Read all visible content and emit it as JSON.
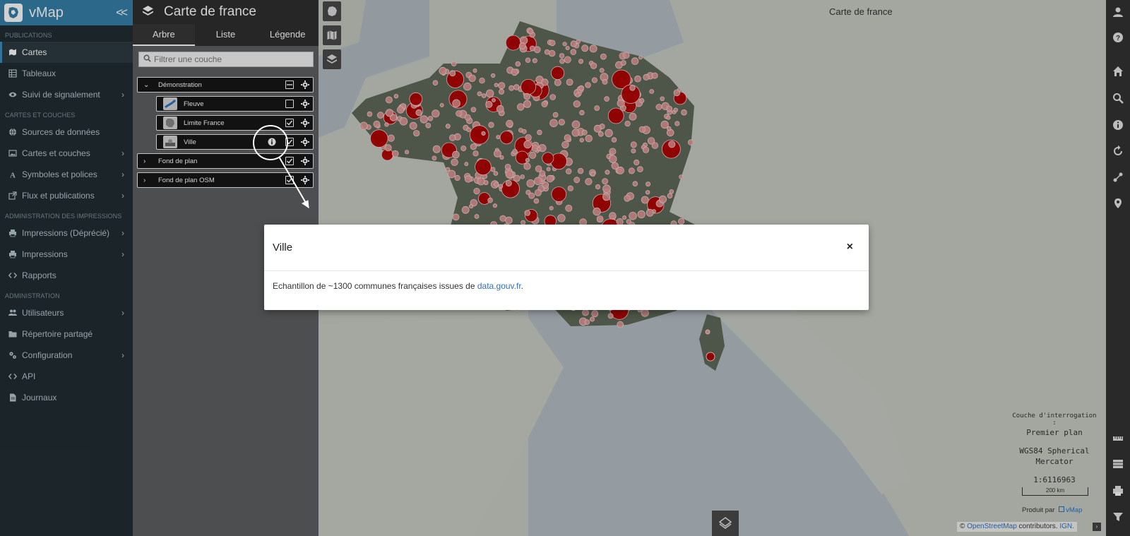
{
  "app": {
    "name": "vMap",
    "collapse_glyph": "<<"
  },
  "sidebar": {
    "sections": [
      {
        "header": "PUBLICATIONS",
        "items": [
          {
            "label": "Cartes",
            "icon": "map-icon",
            "active": true,
            "chevron": false
          },
          {
            "label": "Tableaux",
            "icon": "table-icon",
            "active": false,
            "chevron": false
          },
          {
            "label": "Suivi de signalement",
            "icon": "eye-icon",
            "active": false,
            "chevron": true
          }
        ]
      },
      {
        "header": "CARTES ET COUCHES",
        "items": [
          {
            "label": "Sources de données",
            "icon": "globe-icon",
            "active": false,
            "chevron": false
          },
          {
            "label": "Cartes et couches",
            "icon": "image-icon",
            "active": false,
            "chevron": true
          },
          {
            "label": "Symboles et polices",
            "icon": "font-icon",
            "active": false,
            "chevron": true
          },
          {
            "label": "Flux et publications",
            "icon": "external-link-icon",
            "active": false,
            "chevron": true
          }
        ]
      },
      {
        "header": "ADMINISTRATION DES IMPRESSIONS",
        "items": [
          {
            "label": "Impressions (Déprécié)",
            "icon": "print-icon",
            "active": false,
            "chevron": true
          },
          {
            "label": "Impressions",
            "icon": "print-icon",
            "active": false,
            "chevron": true
          },
          {
            "label": "Rapports",
            "icon": "code-icon",
            "active": false,
            "chevron": false
          }
        ]
      },
      {
        "header": "ADMINISTRATION",
        "items": [
          {
            "label": "Utilisateurs",
            "icon": "users-icon",
            "active": false,
            "chevron": true
          },
          {
            "label": "Répertoire partagé",
            "icon": "folder-icon",
            "active": false,
            "chevron": false
          },
          {
            "label": "Configuration",
            "icon": "cogs-icon",
            "active": false,
            "chevron": true
          },
          {
            "label": "API",
            "icon": "code-icon",
            "active": false,
            "chevron": false
          },
          {
            "label": "Journaux",
            "icon": "file-icon",
            "active": false,
            "chevron": false
          }
        ]
      }
    ]
  },
  "panel": {
    "title": "Carte de france",
    "tabs": [
      {
        "label": "Arbre",
        "active": true
      },
      {
        "label": "Liste",
        "active": false
      },
      {
        "label": "Légende",
        "active": false
      }
    ],
    "filter": {
      "placeholder": "Filtrer une couche",
      "value": ""
    },
    "tree": {
      "group_demo": {
        "label": "Démonstration",
        "expanded": true
      },
      "layers": [
        {
          "label": "Fleuve",
          "checked": false
        },
        {
          "label": "Limite France",
          "checked": true
        },
        {
          "label": "Ville",
          "checked": true
        }
      ],
      "group_fond": {
        "label": "Fond de plan",
        "expanded": false,
        "checked": true
      },
      "group_osm": {
        "label": "Fond de plan OSM",
        "expanded": false,
        "checked": true
      }
    }
  },
  "map": {
    "title": "Carte de france",
    "query_layer_label": "Couche d'interrogation :",
    "query_layer_value": "Premier plan",
    "projection": "WGS84 Spherical Mercator",
    "scale": "1:6116963",
    "scalebar_label": "200 km",
    "produced_by": "Produit par",
    "produced_by_brand": "vMap",
    "attribution_prefix": "©",
    "attribution_osm": "OpenStreetMap",
    "attribution_mid": "contributors.",
    "attribution_ign": "IGN.",
    "attribution_toggle": "›"
  },
  "modal": {
    "title": "Ville",
    "close": "×",
    "body_text": "Echantillon de ~1300 communes françaises issues de",
    "link_text": "data.gouv.fr",
    "body_end": "."
  },
  "colors": {
    "brand": "#367fa9",
    "sidebar_bg": "#222d32",
    "city_dot": "#b30000",
    "link": "#2b72c2"
  }
}
